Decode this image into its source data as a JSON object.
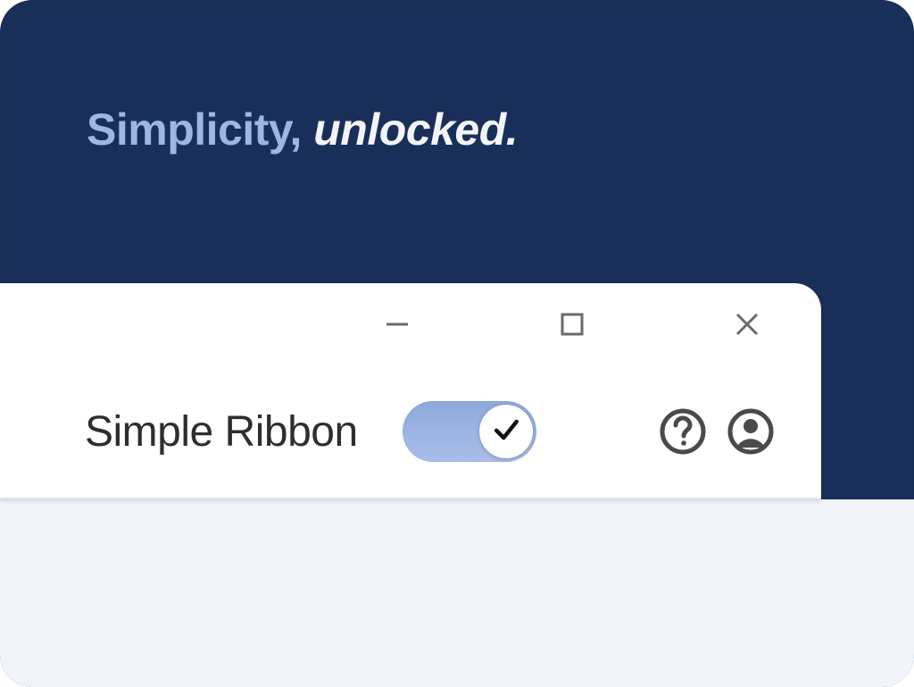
{
  "hero": {
    "tagline_bold": "Simplicity,",
    "tagline_italic": " unlocked."
  },
  "window": {
    "controls": {
      "minimize": "minimize",
      "maximize": "maximize",
      "close": "close"
    },
    "ribbon": {
      "label": "Simple Ribbon",
      "toggle_state": "on",
      "help": "help",
      "account": "account"
    }
  },
  "colors": {
    "hero_bg": "#192f59",
    "accent_periwinkle": "#9db7e4",
    "toggle_fill": "#8da9dc",
    "content_bg": "#f1f5fb",
    "icon_stroke": "#4a4a4a"
  }
}
